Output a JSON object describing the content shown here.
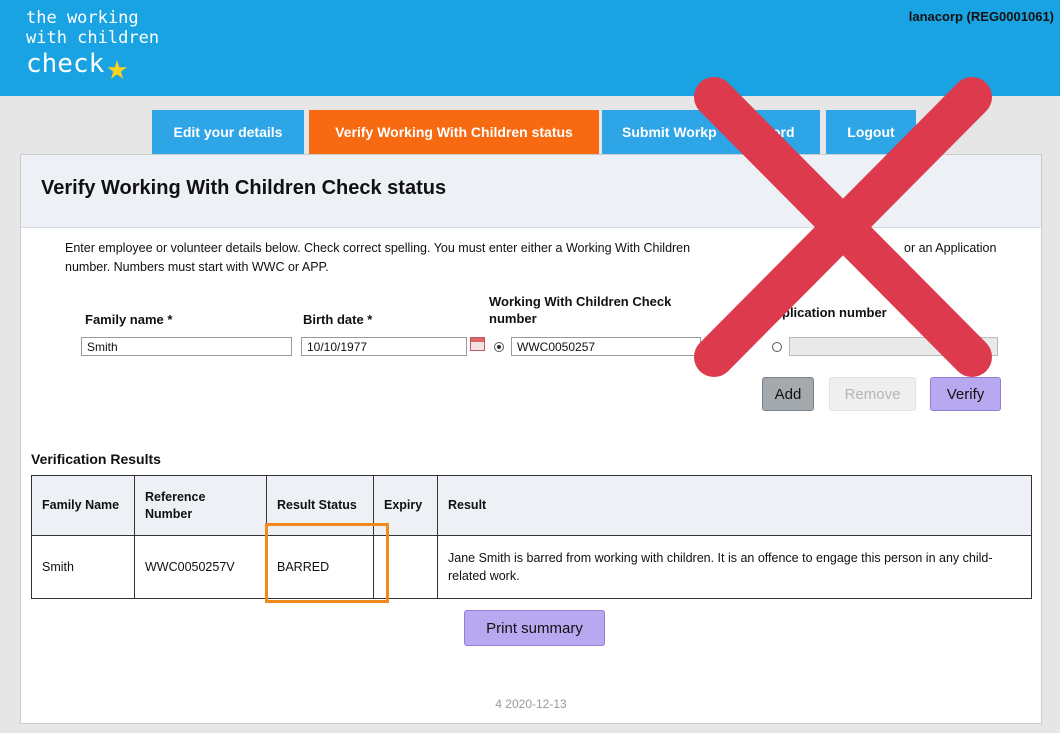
{
  "header": {
    "logo_line1": "the working",
    "logo_line2": "with children",
    "logo_line3": "check",
    "account": "lanacorp (REG0001061)"
  },
  "nav": {
    "tabs": [
      {
        "label": "Edit your details",
        "color": "#2da5e6"
      },
      {
        "label": "Verify Working With Children status",
        "color": "#f76a12"
      },
      {
        "label": "Submit Workp",
        "color": "#2da5e6"
      },
      {
        "label": "ord",
        "color": "#2da5e6"
      },
      {
        "label": "Logout",
        "color": "#2da5e6"
      }
    ]
  },
  "page": {
    "title": "Verify Working With Children Check status",
    "instructions_line1": "Enter employee or volunteer details below. Check correct spelling. You must enter either a Working With Children",
    "instructions_line1b": "or an Application",
    "instructions_line2": "number. Numbers must start with WWC or APP.",
    "form": {
      "family_label": "Family name *",
      "birth_label": "Birth date *",
      "wwc_label_1": "Working With Children Check",
      "wwc_label_2": "number",
      "app_label": "plication number",
      "family_value": "Smith",
      "birth_value": "10/10/1977",
      "wwc_value": "WWC0050257",
      "app_value": ""
    },
    "buttons": {
      "add": "Add",
      "remove": "Remove",
      "verify": "Verify",
      "print": "Print summary"
    },
    "results_title": "Verification Results",
    "table": {
      "headers": [
        "Family Name",
        "Reference Number",
        "Result Status",
        "Expiry",
        "Result"
      ],
      "rows": [
        {
          "family": "Smith",
          "reference": "WWC0050257V",
          "status": "BARRED",
          "expiry": "",
          "result": "Jane Smith is barred from working with children. It is an offence to engage this person in any child-related work."
        }
      ]
    },
    "version": "4 2020-12-13"
  },
  "colors": {
    "header_bg": "#1aa3e2",
    "tab_blue": "#2da5e6",
    "tab_orange": "#f76a12",
    "highlight": "#f08a1c",
    "xmark": "#dd3a4d",
    "verify_btn": "#b8a8ef"
  }
}
